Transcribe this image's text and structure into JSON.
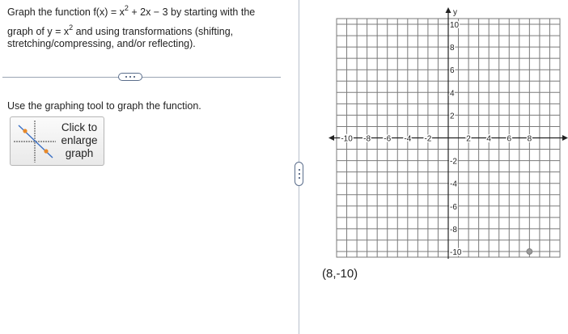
{
  "question": {
    "line1_pre": "Graph the function f(x) = x",
    "line1_exp": "2",
    "line1_post": " + 2x − 3 by starting with the",
    "line2_pre": "graph of y = x",
    "line2_exp": "2",
    "line2_post": " and using transformations (shifting,",
    "line3": "stretching/compressing, and/or reflecting)."
  },
  "instruction": "Use the graphing tool to graph the function.",
  "enlarge_button": {
    "line1": "Click to",
    "line2": "enlarge",
    "line3": "graph"
  },
  "graph": {
    "xmin": -11,
    "xmax": 11,
    "ymin": -10.5,
    "ymax": 10.5,
    "x_tick_labels": [
      "-10",
      "-8",
      "-6",
      "-4",
      "-2",
      "2",
      "4",
      "6",
      "8"
    ],
    "y_tick_labels": [
      "10",
      "8",
      "6",
      "4",
      "2",
      "-2",
      "-4",
      "-6",
      "-8",
      "-10"
    ],
    "y_axis_label": "y",
    "point": {
      "x": 8,
      "y": -10
    },
    "point_color": "#9a9a9a",
    "grid_color": "#7a7a7a",
    "axis_color": "#222222"
  },
  "coord_readout": "(8,-10)",
  "icons": {
    "divider_handle": "ellipsis-icon",
    "pane_handle": "vertical-ellipsis-icon",
    "thumbnail": "graph-thumbnail-icon"
  }
}
